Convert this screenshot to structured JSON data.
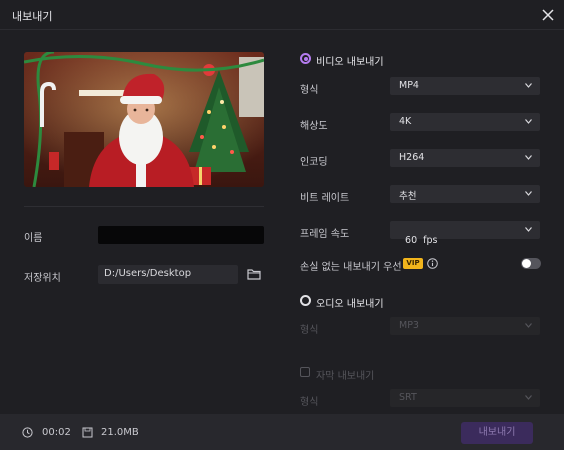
{
  "window": {
    "title": "내보내기"
  },
  "left": {
    "name_label": "이름",
    "name_value": "",
    "save_label": "저장위치",
    "save_path": "D:/Users/Desktop"
  },
  "video": {
    "title": "비디오 내보내기",
    "selected": true,
    "rows": [
      {
        "label": "형식",
        "value": "MP4"
      },
      {
        "label": "해상도",
        "value": "4K"
      },
      {
        "label": "인코딩",
        "value": "H264"
      },
      {
        "label": "비트 레이트",
        "value": "추천"
      },
      {
        "label": "프레임 속도",
        "value": "60  fps"
      }
    ],
    "lossless_label": "손실 없는 내보내기 우선",
    "vip": "VIP",
    "lossless_enabled": false
  },
  "audio": {
    "title": "오디오 내보내기",
    "selected": false,
    "format_label": "형식",
    "format_value": "MP3"
  },
  "subtitle": {
    "title": "자막 내보내기",
    "checked": false,
    "format_label": "형식",
    "format_value": "SRT"
  },
  "footer": {
    "duration": "00:02",
    "size": "21.0MB",
    "export_label": "내보내기"
  },
  "colors": {
    "accent": "#b57cf0",
    "vip": "#f2b51c",
    "export_bg": "#3b2b5c"
  },
  "icons": [
    "close-icon",
    "folder-icon",
    "chevron-down-icon",
    "info-icon",
    "clock-icon",
    "save-icon"
  ]
}
